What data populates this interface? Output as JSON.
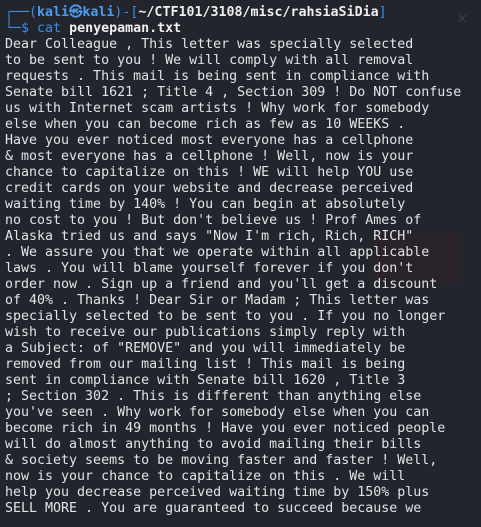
{
  "prompt": {
    "user": "kali",
    "separator": "㉿",
    "host": "kali",
    "cwd": "~/CTF101/3108/misc/rahsiaSiDia",
    "symbol": "$",
    "command": "cat",
    "argument": "penyepaman.txt"
  },
  "output_lines": [
    "Dear Colleague , This letter was specially selected",
    "to be sent to you ! We will comply with all removal",
    "requests . This mail is being sent in compliance with",
    "Senate bill 1621 ; Title 4 , Section 309 ! Do NOT confuse",
    "us with Internet scam artists ! Why work for somebody",
    "else when you can become rich as few as 10 WEEKS .",
    "Have you ever noticed most everyone has a cellphone",
    "& most everyone has a cellphone ! Well, now is your",
    "chance to capitalize on this ! WE will help YOU use",
    "credit cards on your website and decrease perceived",
    "waiting time by 140% ! You can begin at absolutely",
    "no cost to you ! But don't believe us ! Prof Ames of",
    "Alaska tried us and says \"Now I'm rich, Rich, RICH\"",
    ". We assure you that we operate within all applicable",
    "laws . You will blame yourself forever if you don't",
    "order now . Sign up a friend and you'll get a discount",
    "of 40% . Thanks ! Dear Sir or Madam ; This letter was",
    "specially selected to be sent to you . If you no longer",
    "wish to receive our publications simply reply with",
    "a Subject: of \"REMOVE\" and you will immediately be",
    "removed from our mailing list ! This mail is being",
    "sent in compliance with Senate bill 1620 , Title 3",
    "; Section 302 . This is different than anything else",
    "you've seen . Why work for somebody else when you can",
    "become rich in 49 months ! Have you ever noticed people",
    "will do almost anything to avoid mailing their bills",
    "& society seems to be moving faster and faster ! Well,",
    "now is your chance to capitalize on this . We will",
    "help you decrease perceived waiting time by 150% plus",
    "SELL MORE . You are guaranteed to succeed because we"
  ]
}
